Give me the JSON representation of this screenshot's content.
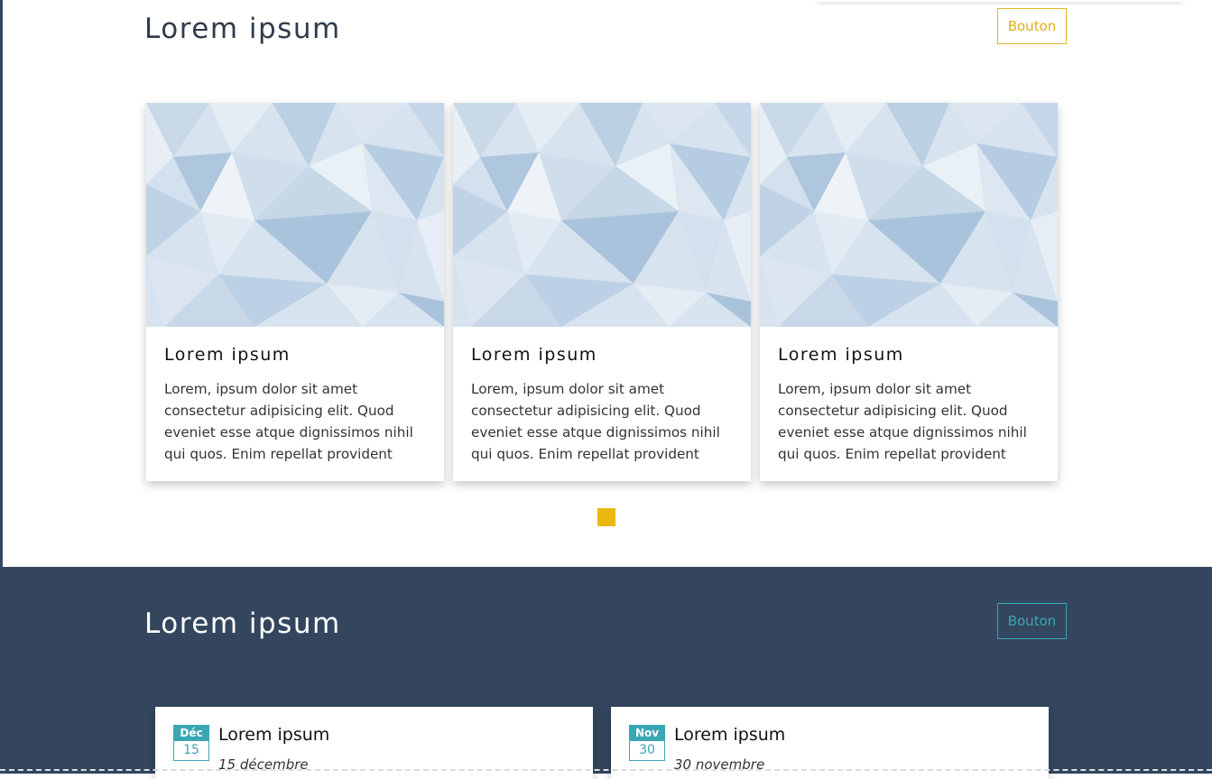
{
  "colors": {
    "accent_gold": "#e8b80f",
    "accent_teal": "#3aa6b4",
    "dark_section": "#34465e",
    "pattern_base": "#d7e3ee"
  },
  "featured": {
    "title": "Lorem ipsum",
    "button_label": "Bouton",
    "cards": [
      {
        "image": "low-poly-pattern",
        "title": "Lorem ipsum",
        "text": "Lorem, ipsum dolor sit amet consectetur adipisicing elit. Quod eveniet esse atque dignissimos nihil qui quos. Enim repellat provident"
      },
      {
        "image": "low-poly-pattern",
        "title": "Lorem ipsum",
        "text": "Lorem, ipsum dolor sit amet consectetur adipisicing elit. Quod eveniet esse atque dignissimos nihil qui quos. Enim repellat provident"
      },
      {
        "image": "low-poly-pattern",
        "title": "Lorem ipsum",
        "text": "Lorem, ipsum dolor sit amet consectetur adipisicing elit. Quod eveniet esse atque dignissimos nihil qui quos. Enim repellat provident"
      }
    ]
  },
  "events": {
    "title": "Lorem ipsum",
    "button_label": "Bouton",
    "items": [
      {
        "month": "Déc",
        "day": "15",
        "title": "Lorem ipsum",
        "date": "15 décembre"
      },
      {
        "month": "Nov",
        "day": "30",
        "title": "Lorem ipsum",
        "date": "30 novembre"
      }
    ]
  }
}
